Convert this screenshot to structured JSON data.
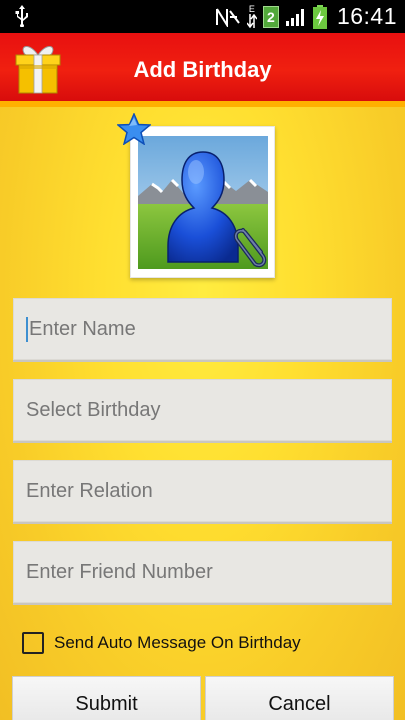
{
  "status_bar": {
    "time": "16:41",
    "notification_count": "2",
    "network_type": "E",
    "icons": [
      "usb-icon",
      "nfc-icon",
      "data-arrows-icon",
      "notification-badge",
      "signal-icon",
      "battery-charging-icon"
    ]
  },
  "app_bar": {
    "title": "Add Birthday",
    "icon": "gift-box-icon",
    "background_color": "#e81010"
  },
  "avatar": {
    "icon": "person-silhouette-icon",
    "badge_icon": "star-icon",
    "attach_icon": "paperclip-icon"
  },
  "form": {
    "name": {
      "value": "",
      "placeholder": "Enter Name",
      "focused": true
    },
    "birthday": {
      "value": "",
      "placeholder": "Select Birthday"
    },
    "relation": {
      "value": "",
      "placeholder": "Enter Relation"
    },
    "friend_number": {
      "value": "",
      "placeholder": "Enter Friend Number"
    },
    "auto_message": {
      "label": "Send Auto Message On Birthday",
      "checked": false
    }
  },
  "buttons": {
    "submit": "Submit",
    "cancel": "Cancel"
  }
}
